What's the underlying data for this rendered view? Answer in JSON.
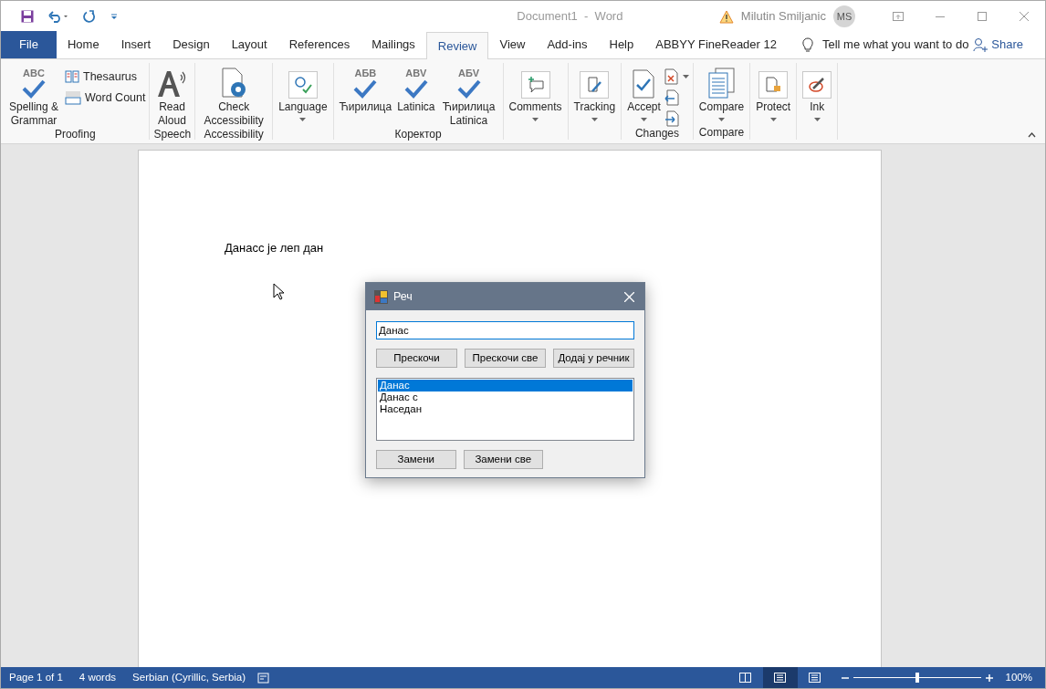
{
  "title_bar": {
    "title": "Document1  -  Word",
    "user": "Milutin Smiljanic",
    "initials": "MS"
  },
  "tabs": [
    {
      "label": "File",
      "kind": "file",
      "selected": false
    },
    {
      "label": "Home",
      "kind": "tab",
      "selected": false
    },
    {
      "label": "Insert",
      "kind": "tab",
      "selected": false
    },
    {
      "label": "Design",
      "kind": "tab",
      "selected": false
    },
    {
      "label": "Layout",
      "kind": "tab",
      "selected": false
    },
    {
      "label": "References",
      "kind": "tab",
      "selected": false
    },
    {
      "label": "Mailings",
      "kind": "tab",
      "selected": false
    },
    {
      "label": "Review",
      "kind": "tab",
      "selected": true
    },
    {
      "label": "View",
      "kind": "tab",
      "selected": false
    },
    {
      "label": "Add-ins",
      "kind": "tab",
      "selected": false
    },
    {
      "label": "Help",
      "kind": "tab",
      "selected": false
    },
    {
      "label": "ABBYY FineReader 12",
      "kind": "tab",
      "selected": false
    }
  ],
  "tell_me": "Tell me what you want to do",
  "share": "Share",
  "ribbon_groups": [
    {
      "label": "Proofing",
      "items": [
        {
          "kind": "large",
          "icon_text": "ABC",
          "label": "Spelling & Grammar"
        },
        {
          "kind": "stack",
          "buttons": [
            {
              "kind": "labeled",
              "label": "Thesaurus"
            },
            {
              "kind": "labeled",
              "label": "Word Count"
            }
          ]
        }
      ]
    },
    {
      "label": "Speech",
      "items": [
        {
          "kind": "large",
          "label": "Read Aloud"
        }
      ]
    },
    {
      "label": "Accessibility",
      "items": [
        {
          "kind": "large",
          "label": "Check Accessibility"
        }
      ]
    },
    {
      "items": [
        {
          "kind": "large",
          "label": "Language",
          "dropdown": true
        }
      ]
    },
    {
      "label": "Коректор",
      "items": [
        {
          "kind": "large",
          "icon_text": "АБВ",
          "label": "Ћирилица"
        },
        {
          "kind": "large",
          "icon_text": "ABV",
          "label": "Latinica"
        },
        {
          "kind": "large",
          "icon_text": "АБV",
          "label": "Ћирилица Latinica"
        }
      ]
    },
    {
      "items": [
        {
          "kind": "large",
          "label": "Comments",
          "dropdown": true
        }
      ]
    },
    {
      "items": [
        {
          "kind": "large",
          "label": "Tracking",
          "dropdown": true
        }
      ]
    },
    {
      "label": "Changes",
      "items": [
        {
          "kind": "large",
          "label": "Accept",
          "dropdown": true
        },
        {
          "kind": "stack",
          "buttons": [
            {
              "kind": "icon",
              "dropdown": true
            },
            {
              "kind": "icon"
            },
            {
              "kind": "icon"
            }
          ]
        }
      ]
    },
    {
      "label": "Compare",
      "items": [
        {
          "kind": "large",
          "label": "Compare",
          "dropdown": true
        }
      ]
    },
    {
      "items": [
        {
          "kind": "large",
          "label": "Protect",
          "dropdown": true
        }
      ]
    },
    {
      "items": [
        {
          "kind": "large",
          "label": "Ink",
          "dropdown": true
        }
      ]
    }
  ],
  "document": {
    "text": "Данасс је леп дан"
  },
  "dialog": {
    "title": "Реч",
    "value": "Данас",
    "buttons": [
      "Прескочи",
      "Прескочи све",
      "Додај у речник"
    ],
    "suggestions": [
      {
        "label": "Данас",
        "selected": true
      },
      {
        "label": "Данас с",
        "selected": false
      },
      {
        "label": "Наседан",
        "selected": false
      }
    ],
    "bottom_buttons": [
      "Замени",
      "Замени све"
    ]
  },
  "status_bar": {
    "items": [
      "Page 1 of 1",
      "4 words",
      "Serbian (Cyrillic, Serbia)"
    ],
    "views": [
      {
        "selected": false
      },
      {
        "selected": true
      },
      {
        "selected": false
      }
    ],
    "zoom": {
      "level": 0.5,
      "reading": "100%"
    }
  }
}
